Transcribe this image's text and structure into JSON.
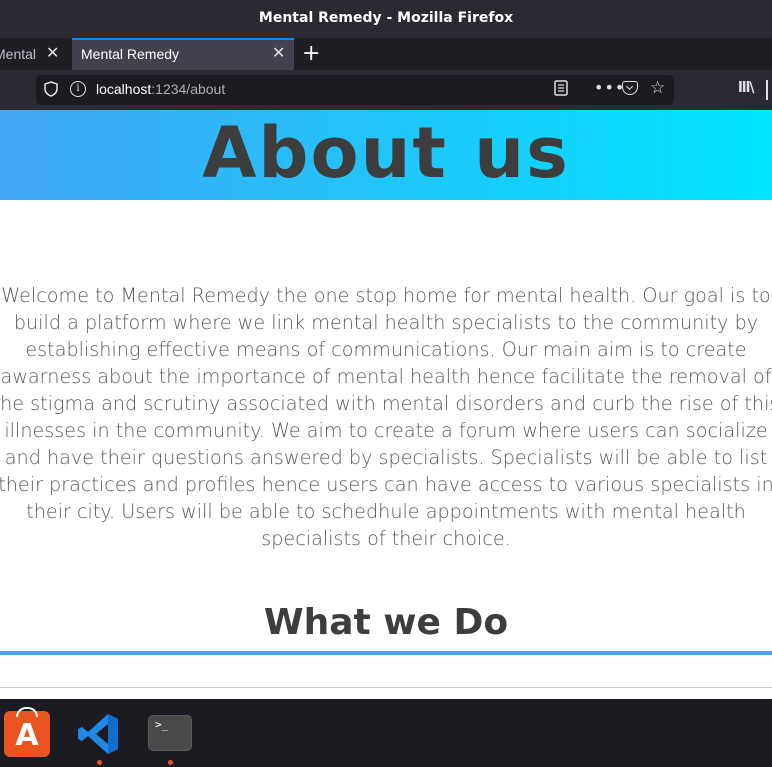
{
  "window": {
    "title": "Mental Remedy - Mozilla Firefox"
  },
  "tabs": [
    {
      "label": "Mental Remedy - F",
      "active": false
    },
    {
      "label": "Mental Remedy",
      "active": true
    }
  ],
  "tab_controls": {
    "close_glyph": "✕",
    "new_tab_glyph": "+"
  },
  "address_bar": {
    "host": "localhost",
    "path": ":1234/about"
  },
  "toolbar_icons": {
    "more_glyph": "•••",
    "bookmark_glyph": "☆",
    "library_glyph": "lll\\"
  },
  "page": {
    "hero_title": "About us",
    "intro_text": "Welcome to Mental Remedy the one stop home for mental health. Our goal is to build a platform where we link mental health specialists to the community by establishing effective means of communications. Our main aim is to create awarness about the importance of mental health hence facilitate the removal of the stigma and scrutiny associated with mental disorders and curb the rise of this illnesses in the community. We aim to create a forum where users can socialize and have their questions answered by specialists. Specialists will be able to list their practices and profiles hence users can have access to various specialists in their city. Users will be able to schedhule appointments with mental health specialists of their choice.",
    "section_heading": "What we Do"
  },
  "dock": {
    "items": [
      "ubuntu-software",
      "visual-studio-code",
      "terminal"
    ],
    "appstore_glyph": "A",
    "terminal_prompt": ">_"
  },
  "colors": {
    "hero_gradient_start": "#42a5f5",
    "hero_gradient_end": "#00e5ff",
    "heading_text": "#3d3d3d",
    "body_text": "#5a5a5a",
    "divider": "#4fa3e0",
    "active_tab_accent": "#0a84ff",
    "dock_indicator": "#e95420"
  }
}
